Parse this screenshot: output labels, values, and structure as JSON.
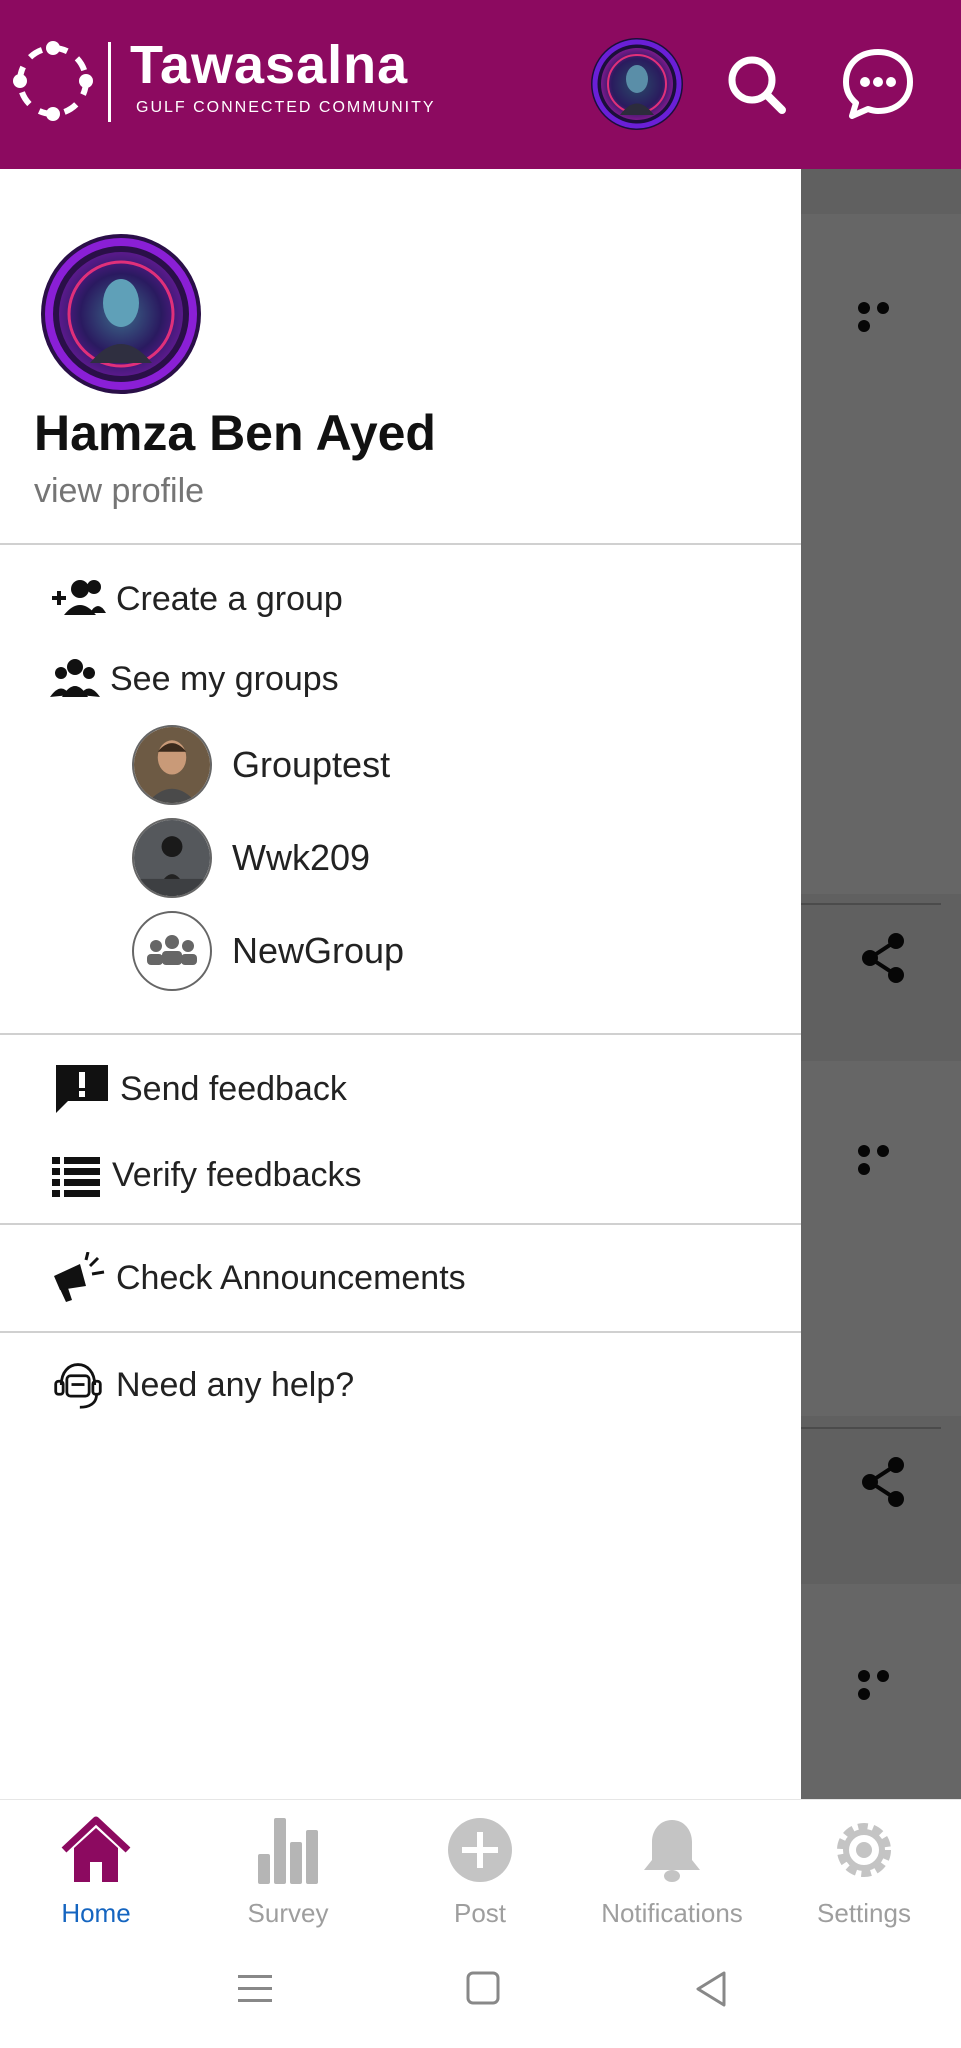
{
  "colors": {
    "brand": "#8c0a60",
    "active_nav": "#1565c0",
    "inactive_nav": "#b5b5b5",
    "overlay": "rgba(0,0,0,0.6)"
  },
  "header": {
    "brand_name": "Tawasalna",
    "brand_tagline": "GULF CONNECTED COMMUNITY",
    "icons": [
      "logo-ring-icon",
      "avatar",
      "search-icon",
      "chat-icon"
    ]
  },
  "drawer": {
    "profile": {
      "name": "Hamza Ben Ayed",
      "view_profile": "view profile"
    },
    "menu": {
      "create_group": "Create a group",
      "see_groups": "See my groups",
      "send_feedback": "Send feedback",
      "verify_feedbacks": "Verify feedbacks",
      "announcements": "Check Announcements",
      "help": "Need any help?"
    },
    "groups": [
      {
        "name": "Grouptest"
      },
      {
        "name": "Wwk209"
      },
      {
        "name": "NewGroup"
      }
    ]
  },
  "bottom_nav": {
    "items": [
      {
        "label": "Home",
        "icon": "home-icon",
        "active": true
      },
      {
        "label": "Survey",
        "icon": "bar-chart-icon",
        "active": false
      },
      {
        "label": "Post",
        "icon": "plus-circle-icon",
        "active": false
      },
      {
        "label": "Notifications",
        "icon": "bell-icon",
        "active": false
      },
      {
        "label": "Settings",
        "icon": "gear-icon",
        "active": false
      }
    ]
  },
  "system_bar": {
    "icons": [
      "recent-apps-icon",
      "home-square-icon",
      "back-triangle-icon"
    ]
  }
}
